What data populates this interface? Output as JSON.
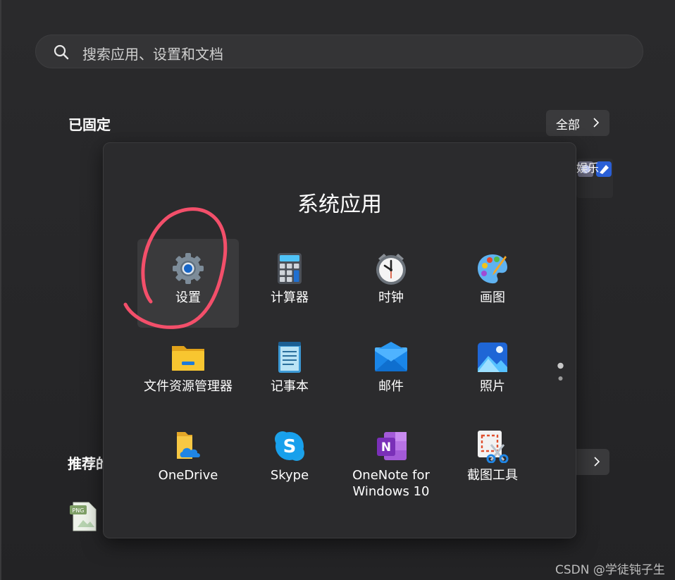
{
  "search": {
    "placeholder": "搜索应用、设置和文档"
  },
  "pinned": {
    "title": "已固定",
    "all_label": "全部"
  },
  "entertainment": {
    "label": "娱乐"
  },
  "recommended": {
    "title_visible": "推荐的"
  },
  "folder": {
    "title": "系统应用",
    "apps": [
      {
        "name": "设置",
        "icon": "settings-gear-icon",
        "selected": true
      },
      {
        "name": "计算器",
        "icon": "calculator-icon"
      },
      {
        "name": "时钟",
        "icon": "clock-icon"
      },
      {
        "name": "画图",
        "icon": "paint-palette-icon"
      },
      {
        "name": "文件资源管理器",
        "icon": "file-explorer-folder-icon"
      },
      {
        "name": "记事本",
        "icon": "notepad-icon"
      },
      {
        "name": "邮件",
        "icon": "mail-icon"
      },
      {
        "name": "照片",
        "icon": "photos-icon"
      },
      {
        "name": "OneDrive",
        "icon": "onedrive-icon"
      },
      {
        "name": "Skype",
        "icon": "skype-icon"
      },
      {
        "name": "OneNote for\nWindows 10",
        "icon": "onenote-icon"
      },
      {
        "name": "截图工具",
        "icon": "snipping-tool-icon"
      }
    ]
  },
  "recent_file": {
    "badge": "PNG"
  },
  "watermark": "CSDN @学徒钝子生"
}
